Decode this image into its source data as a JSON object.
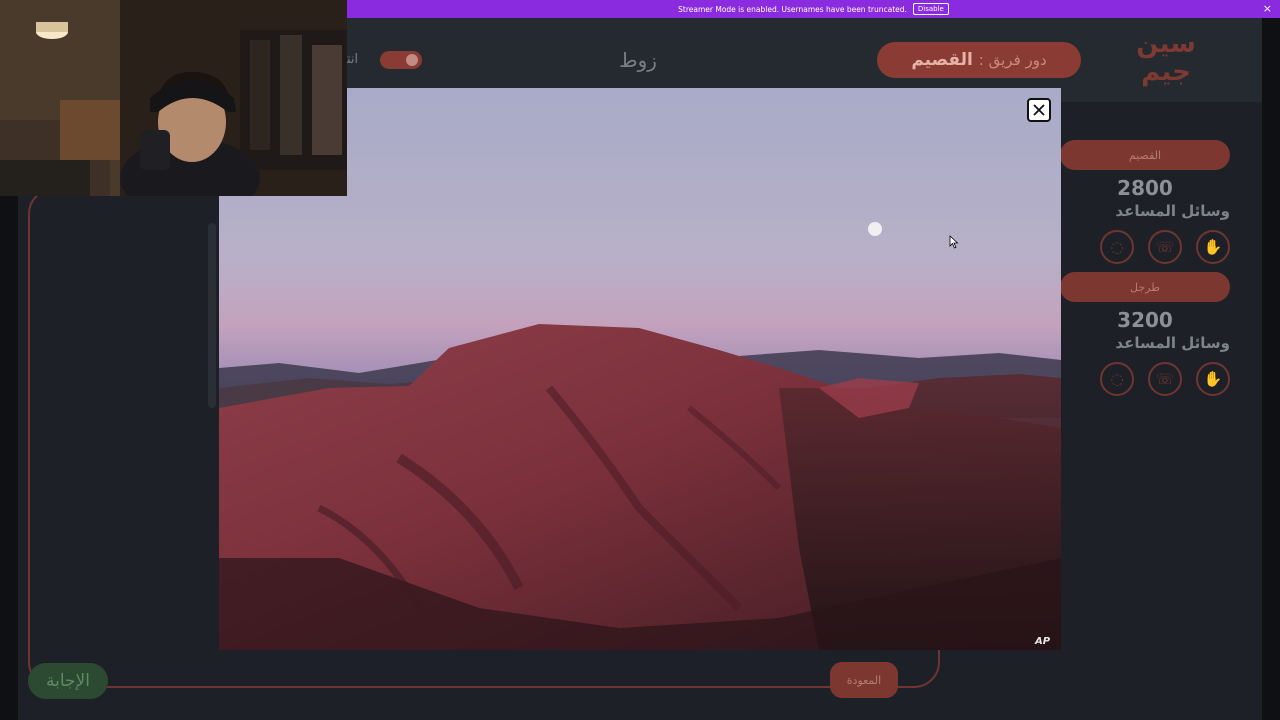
{
  "banner": {
    "text": "Streamer Mode is enabled. Usernames have been truncated.",
    "disable_label": "Disable",
    "close_glyph": "×"
  },
  "header": {
    "turn_prefix": "دور فريق :",
    "turn_team": "القصيم",
    "word": "زوط",
    "end_label": "انته",
    "logo_text": "سين جيم"
  },
  "teams": [
    {
      "name": "القصيم",
      "score": "2800",
      "aids_label": "وسائل المساعد"
    },
    {
      "name": "طرجل",
      "score": "3200",
      "aids_label": "وسائل المساعد"
    }
  ],
  "buttons": {
    "answer": "الإجابة",
    "back": "المعودة"
  },
  "image": {
    "credit": "AP",
    "close_glyph": "✕"
  },
  "colors": {
    "banner": "#8b2bdf",
    "accent": "#8a3b33",
    "answer_green": "#2b4a31",
    "app_bg": "#1d2127"
  }
}
